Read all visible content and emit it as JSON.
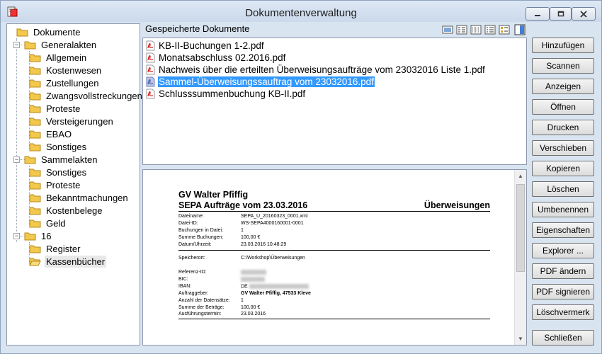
{
  "window": {
    "title": "Dokumentenverwaltung"
  },
  "tree": {
    "items": [
      {
        "label": "Dokumente"
      },
      {
        "label": "Generalakten"
      },
      {
        "label": "Allgemein"
      },
      {
        "label": "Kostenwesen"
      },
      {
        "label": "Zustellungen"
      },
      {
        "label": "Zwangsvollstreckungen"
      },
      {
        "label": "Proteste"
      },
      {
        "label": "Versteigerungen"
      },
      {
        "label": "EBAO"
      },
      {
        "label": "Sonstiges"
      },
      {
        "label": "Sammelakten"
      },
      {
        "label": "Sonstiges"
      },
      {
        "label": "Proteste"
      },
      {
        "label": "Bekanntmachungen"
      },
      {
        "label": "Kostenbelege"
      },
      {
        "label": "Geld"
      },
      {
        "label": "16"
      },
      {
        "label": "Register"
      },
      {
        "label": "Kassenbücher"
      }
    ],
    "selected": "Kassenbücher"
  },
  "list": {
    "header": "Gespeicherte Dokumente",
    "documents": [
      "KB-II-Buchungen 1-2.pdf",
      "Monatsabschluss 02.2016.pdf",
      "Nachweis über die erteilten Überweisungsaufträge vom 23032016 Liste 1.pdf",
      "Sammel-Überweisungssauftrag vom 23032016.pdf",
      "Schlusssummenbuchung KB-II.pdf"
    ],
    "selected_index": 3,
    "view_icons": [
      "large-icons-view-icon",
      "list-view-icon",
      "details-view-icon",
      "tiles-view-icon",
      "thumbnail-view-icon",
      "preview-pane-icon"
    ]
  },
  "preview": {
    "name": "GV Walter Pfiffig",
    "title": "SEPA Aufträge vom 23.03.2016",
    "type": "Überweisungen",
    "fields": [
      {
        "k": "Dateiname:",
        "v": "SEPA_U_20160323_0001.xml"
      },
      {
        "k": "Datei-ID:",
        "v": "WS-SEPA4000160001-0001"
      },
      {
        "k": "Buchungen in Datei:",
        "v": "1"
      },
      {
        "k": "Summe Buchungen:",
        "v": "100,00 €"
      },
      {
        "k": "Datum/Uhrzeit:",
        "v": "23.03.2016 10:48:29"
      }
    ],
    "storage": {
      "k": "Speicherort:",
      "v": "C:\\Workshop\\Überweisungen"
    },
    "details": [
      {
        "k": "Referenz-ID:",
        "v": ""
      },
      {
        "k": "BIC:",
        "v": ""
      },
      {
        "k": "IBAN:",
        "v": "DE"
      },
      {
        "k": "Auftraggeber:",
        "v": "GV Walter Pfiffig, 47533 Kleve"
      },
      {
        "k": "Anzahl der Datensätze:",
        "v": "1"
      },
      {
        "k": "Summe der Beträge:",
        "v": "100,00 €"
      },
      {
        "k": "Ausführungstermin:",
        "v": "23.03.2016"
      }
    ]
  },
  "buttons": {
    "add": "Hinzufügen",
    "scan": "Scannen",
    "show": "Anzeigen",
    "open": "Öffnen",
    "print": "Drucken",
    "move": "Verschieben",
    "copy": "Kopieren",
    "delete": "Löschen",
    "rename": "Umbenennen",
    "properties": "Eigenschaften",
    "explorer": "Explorer ...",
    "pdf_edit": "PDF ändern",
    "pdf_sign": "PDF signieren",
    "delete_mark": "Löschvermerk",
    "close": "Schließen"
  },
  "colors": {
    "selection": "#3399ff",
    "folder": "#f2c94c",
    "pdf_red": "#d21f1f",
    "window_bg": "#d9e4f1"
  }
}
